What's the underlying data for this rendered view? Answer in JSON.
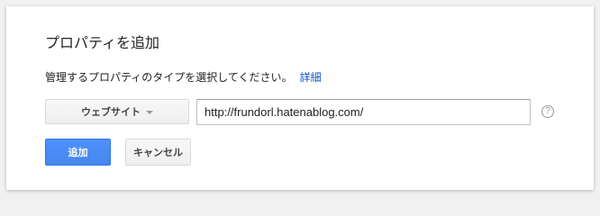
{
  "dialog": {
    "title": "プロパティを追加",
    "description": "管理するプロパティのタイプを選択してください。",
    "details_link": "詳細"
  },
  "property_type": {
    "selected": "ウェブサイト",
    "caret_icon": "chevron-down-icon"
  },
  "url_field": {
    "value": "http://frundorl.hatenablog.com/",
    "placeholder": ""
  },
  "help": {
    "icon": "help-icon",
    "glyph": "?"
  },
  "buttons": {
    "add_label": "追加",
    "cancel_label": "キャンセル"
  },
  "colors": {
    "accent": "#4d90fe",
    "link": "#1155cc"
  }
}
